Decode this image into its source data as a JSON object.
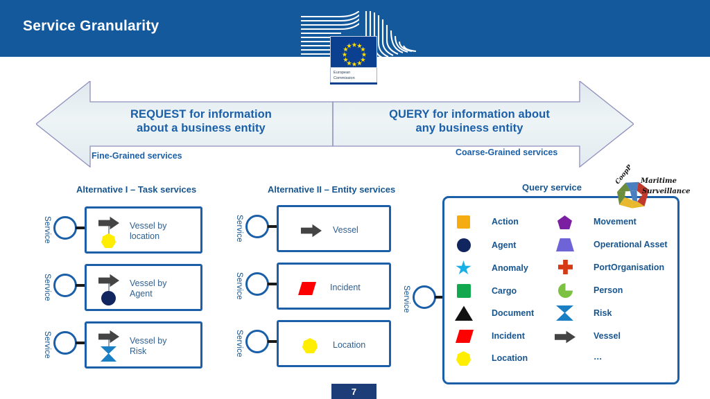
{
  "header": {
    "title": "Service Granularity",
    "bg_color": "#14599b",
    "logo": {
      "name": "european-commission-logo",
      "caption_line1": "European",
      "caption_line2": "Commission"
    }
  },
  "banner": {
    "left_text_line1": "REQUEST for information",
    "left_text_line2": "about a business entity",
    "right_text_line1": "QUERY for information about",
    "right_text_line2": "any business entity",
    "left_sub": "Fine-Grained services",
    "right_sub": "Coarse-Grained services",
    "accent_color": "#1a5fa8"
  },
  "columns": [
    {
      "title": "Alternative I – Task services",
      "rows": [
        {
          "service_label": "Service",
          "text_line1": "Vessel by",
          "text_line2": "location",
          "icon_top": "vessel-arrow-icon",
          "icon_bottom": "location-heptagon-icon",
          "icon_bottom_color": "#ffee00"
        },
        {
          "service_label": "Service",
          "text_line1": "Vessel by",
          "text_line2": "Agent",
          "icon_top": "vessel-arrow-icon",
          "icon_bottom": "agent-circle-icon",
          "icon_bottom_color": "#11255f"
        },
        {
          "service_label": "Service",
          "text_line1": "Vessel by",
          "text_line2": "Risk",
          "icon_top": "vessel-arrow-icon",
          "icon_bottom": "risk-hourglass-icon",
          "icon_bottom_color": "#1b7fc4"
        }
      ]
    },
    {
      "title": "Alternative II – Entity services",
      "rows": [
        {
          "service_label": "Service",
          "text_line1": "Vessel",
          "icon": "vessel-arrow-icon",
          "icon_color": "#444444"
        },
        {
          "service_label": "Service",
          "text_line1": "Incident",
          "icon": "incident-parallelogram-icon",
          "icon_color": "#ff0000"
        },
        {
          "service_label": "Service",
          "text_line1": "Location",
          "icon": "location-heptagon-icon",
          "icon_color": "#ffee00"
        }
      ]
    }
  ],
  "query": {
    "title": "Query service",
    "service_label": "Service",
    "legend_left": [
      {
        "label": "Action",
        "shape": "square",
        "color": "#f5ac10"
      },
      {
        "label": "Agent",
        "shape": "circle",
        "color": "#11255f"
      },
      {
        "label": "Anomaly",
        "shape": "star",
        "color": "#19b0e6"
      },
      {
        "label": "Cargo",
        "shape": "square",
        "color": "#12a84e"
      },
      {
        "label": "Document",
        "shape": "triangle",
        "color": "#111111"
      },
      {
        "label": "Incident",
        "shape": "parallelogram",
        "color": "#ff0000"
      },
      {
        "label": "Location",
        "shape": "heptagon",
        "color": "#ffee00"
      }
    ],
    "legend_right": [
      {
        "label": "Movement",
        "shape": "pentagon",
        "color": "#7b1fa2"
      },
      {
        "label": "Operational Asset",
        "shape": "trapezoid",
        "color": "#6f63d8"
      },
      {
        "label": "PortOrganisation",
        "shape": "cross",
        "color": "#d63b16"
      },
      {
        "label": "Person",
        "shape": "pacman",
        "color": "#7cc142"
      },
      {
        "label": "Risk",
        "shape": "hourglass",
        "color": "#1b7fc4"
      },
      {
        "label": "Vessel",
        "shape": "arrow",
        "color": "#444444"
      },
      {
        "label": "…",
        "shape": "none",
        "color": "#17558f"
      }
    ],
    "maritime_logo": {
      "name": "maritime-surveillance-logo",
      "coop_text": "CoopP",
      "text_line1": "Maritime",
      "text_line2": "Surveillance"
    }
  },
  "footer": {
    "page_number": "7",
    "bg_color": "#1d3d79"
  }
}
